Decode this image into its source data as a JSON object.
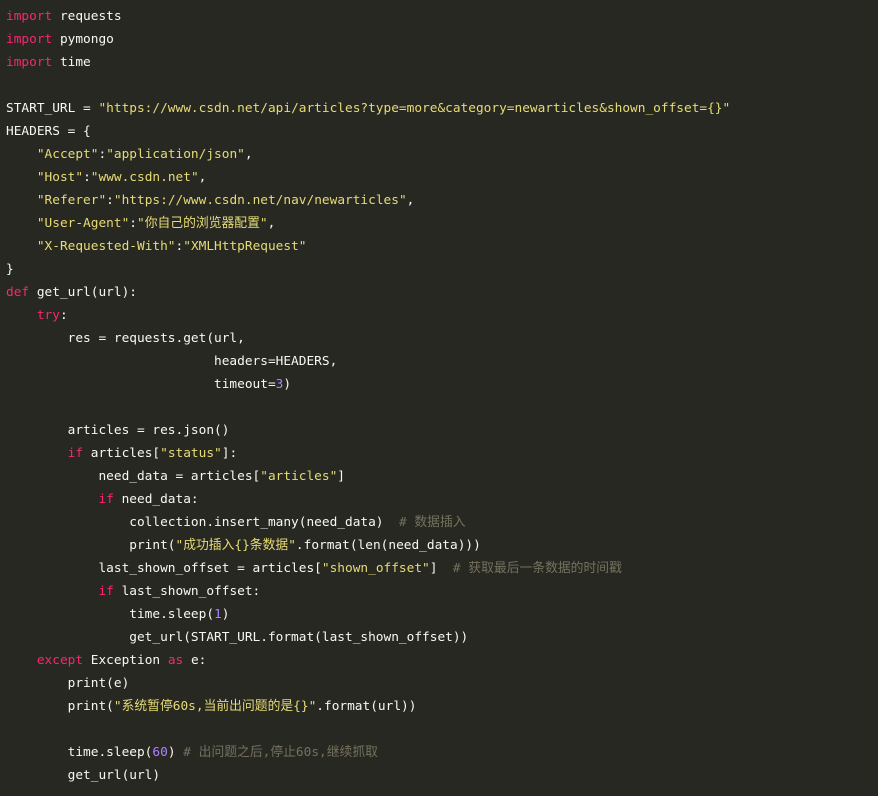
{
  "code": {
    "language": "python",
    "colors": {
      "background": "#272822",
      "plain": "#f8f8f2",
      "keyword": "#f92672",
      "string": "#e6db74",
      "number": "#ae81ff",
      "comment": "#75715e"
    },
    "lines": [
      [
        [
          "kw",
          "import"
        ],
        [
          "pl",
          " requests"
        ]
      ],
      [
        [
          "kw",
          "import"
        ],
        [
          "pl",
          " pymongo"
        ]
      ],
      [
        [
          "kw",
          "import"
        ],
        [
          "pl",
          " time"
        ]
      ],
      [],
      [
        [
          "pl",
          "START_URL = "
        ],
        [
          "str",
          "\"https://www.csdn.net/api/articles?type=more&category=newarticles&shown_offset={}\""
        ]
      ],
      [
        [
          "pl",
          "HEADERS = {"
        ]
      ],
      [
        [
          "pl",
          "    "
        ],
        [
          "str",
          "\"Accept\""
        ],
        [
          "pl",
          ":"
        ],
        [
          "str",
          "\"application/json\""
        ],
        [
          "pl",
          ","
        ]
      ],
      [
        [
          "pl",
          "    "
        ],
        [
          "str",
          "\"Host\""
        ],
        [
          "pl",
          ":"
        ],
        [
          "str",
          "\"www.csdn.net\""
        ],
        [
          "pl",
          ","
        ]
      ],
      [
        [
          "pl",
          "    "
        ],
        [
          "str",
          "\"Referer\""
        ],
        [
          "pl",
          ":"
        ],
        [
          "str",
          "\"https://www.csdn.net/nav/newarticles\""
        ],
        [
          "pl",
          ","
        ]
      ],
      [
        [
          "pl",
          "    "
        ],
        [
          "str",
          "\"User-Agent\""
        ],
        [
          "pl",
          ":"
        ],
        [
          "str",
          "\"你自己的浏览器配置\""
        ],
        [
          "pl",
          ","
        ]
      ],
      [
        [
          "pl",
          "    "
        ],
        [
          "str",
          "\"X-Requested-With\""
        ],
        [
          "pl",
          ":"
        ],
        [
          "str",
          "\"XMLHttpRequest\""
        ]
      ],
      [
        [
          "pl",
          "}"
        ]
      ],
      [
        [
          "kw",
          "def"
        ],
        [
          "pl",
          " get_url(url):"
        ]
      ],
      [
        [
          "pl",
          "    "
        ],
        [
          "kw",
          "try"
        ],
        [
          "pl",
          ":"
        ]
      ],
      [
        [
          "pl",
          "        res = requests.get(url,"
        ]
      ],
      [
        [
          "pl",
          "                           headers=HEADERS,"
        ]
      ],
      [
        [
          "pl",
          "                           timeout="
        ],
        [
          "num",
          "3"
        ],
        [
          "pl",
          ")"
        ]
      ],
      [],
      [
        [
          "pl",
          "        articles = res.json()"
        ]
      ],
      [
        [
          "pl",
          "        "
        ],
        [
          "kw",
          "if"
        ],
        [
          "pl",
          " articles["
        ],
        [
          "str",
          "\"status\""
        ],
        [
          "pl",
          "]:"
        ]
      ],
      [
        [
          "pl",
          "            need_data = articles["
        ],
        [
          "str",
          "\"articles\""
        ],
        [
          "pl",
          "]"
        ]
      ],
      [
        [
          "pl",
          "            "
        ],
        [
          "kw",
          "if"
        ],
        [
          "pl",
          " need_data:"
        ]
      ],
      [
        [
          "pl",
          "                collection.insert_many(need_data)  "
        ],
        [
          "cm",
          "# 数据插入"
        ]
      ],
      [
        [
          "pl",
          "                print("
        ],
        [
          "str",
          "\"成功插入{}条数据\""
        ],
        [
          "pl",
          ".format(len(need_data)))"
        ]
      ],
      [
        [
          "pl",
          "            last_shown_offset = articles["
        ],
        [
          "str",
          "\"shown_offset\""
        ],
        [
          "pl",
          "]  "
        ],
        [
          "cm",
          "# 获取最后一条数据的时间戳"
        ]
      ],
      [
        [
          "pl",
          "            "
        ],
        [
          "kw",
          "if"
        ],
        [
          "pl",
          " last_shown_offset:"
        ]
      ],
      [
        [
          "pl",
          "                time.sleep("
        ],
        [
          "num",
          "1"
        ],
        [
          "pl",
          ")"
        ]
      ],
      [
        [
          "pl",
          "                get_url(START_URL.format(last_shown_offset))"
        ]
      ],
      [
        [
          "pl",
          "    "
        ],
        [
          "kw",
          "except"
        ],
        [
          "pl",
          " Exception "
        ],
        [
          "kw",
          "as"
        ],
        [
          "pl",
          " e:"
        ]
      ],
      [
        [
          "pl",
          "        print(e)"
        ]
      ],
      [
        [
          "pl",
          "        print("
        ],
        [
          "str",
          "\"系统暂停60s,当前出问题的是{}\""
        ],
        [
          "pl",
          ".format(url))"
        ]
      ],
      [],
      [
        [
          "pl",
          "        time.sleep("
        ],
        [
          "num",
          "60"
        ],
        [
          "pl",
          ") "
        ],
        [
          "cm",
          "# 出问题之后,停止60s,继续抓取"
        ]
      ],
      [
        [
          "pl",
          "        get_url(url)"
        ]
      ]
    ]
  }
}
